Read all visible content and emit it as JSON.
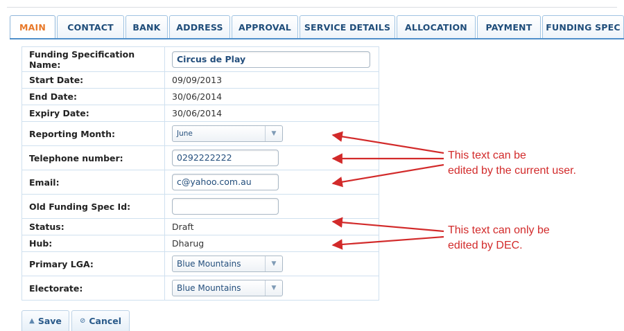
{
  "tabs": [
    "MAIN",
    "CONTACT",
    "BANK",
    "ADDRESS",
    "APPROVAL",
    "SERVICE DETAILS",
    "ALLOCATION",
    "PAYMENT",
    "FUNDING SPEC"
  ],
  "active_tab": "MAIN",
  "form": {
    "funding_spec_name": {
      "label": "Funding Specification Name:",
      "value": "Circus de Play"
    },
    "start_date": {
      "label": "Start Date:",
      "value": "09/09/2013"
    },
    "end_date": {
      "label": "End Date:",
      "value": "30/06/2014"
    },
    "expiry_date": {
      "label": "Expiry Date:",
      "value": "30/06/2014"
    },
    "reporting_month": {
      "label": "Reporting Month:",
      "value": "June"
    },
    "telephone": {
      "label": "Telephone number:",
      "value": "0292222222"
    },
    "email": {
      "label": "Email:",
      "value": "c@yahoo.com.au"
    },
    "old_funding_spec_id": {
      "label": "Old Funding Spec Id:",
      "value": ""
    },
    "status": {
      "label": "Status:",
      "value": "Draft"
    },
    "hub": {
      "label": "Hub:",
      "value": "Dharug"
    },
    "primary_lga": {
      "label": "Primary LGA:",
      "value": "Blue Mountains"
    },
    "electorate": {
      "label": "Electorate:",
      "value": "Blue Mountains"
    }
  },
  "buttons": {
    "save": "Save",
    "cancel": "Cancel"
  },
  "annotations": {
    "editable_line1": "This text can be",
    "editable_line2": "edited by the current user.",
    "dec_line1": "This text can only be",
    "dec_line2": "edited by DEC."
  },
  "colors": {
    "accent": "#e8792a",
    "tab_text": "#1f4d7a",
    "annotation": "#d22a2a",
    "tab_border": "#4f8fca"
  }
}
